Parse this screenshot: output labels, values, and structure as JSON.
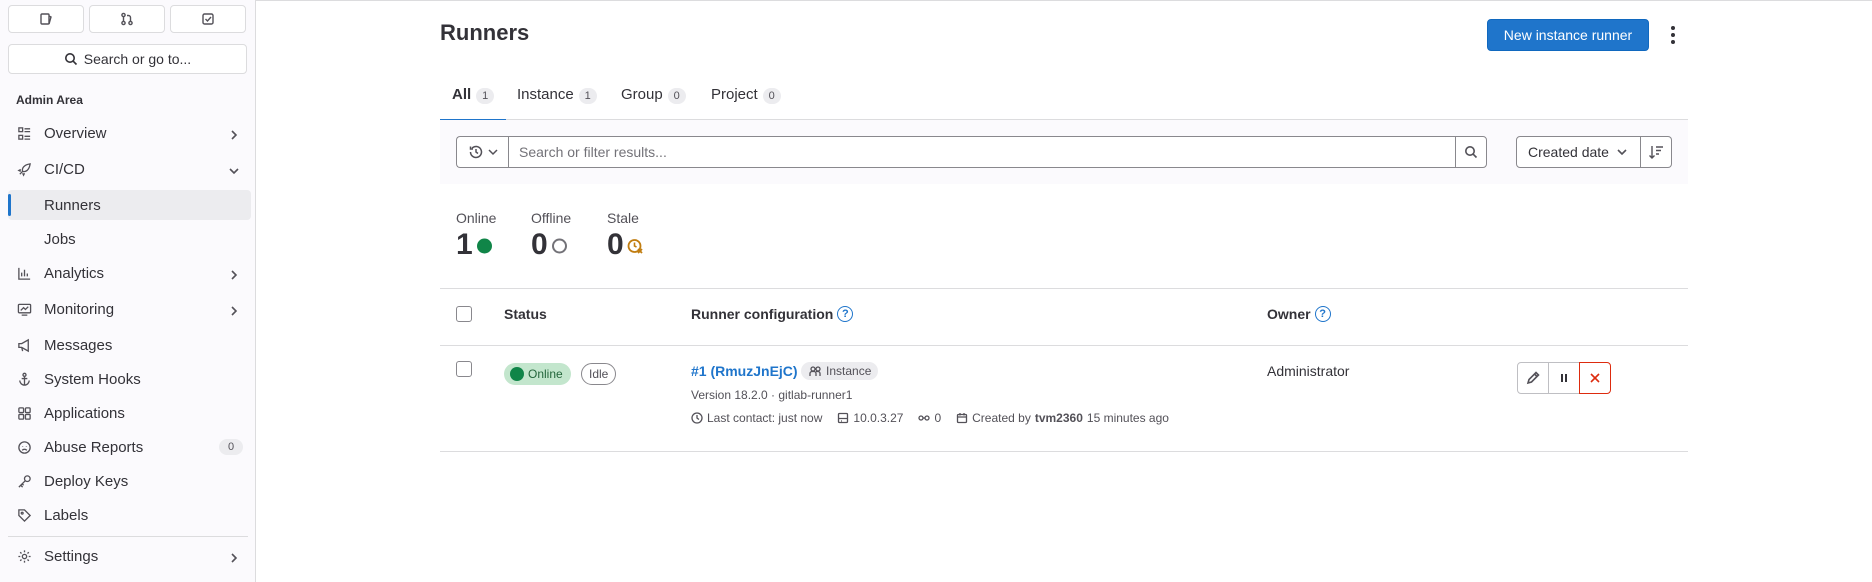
{
  "sidebar": {
    "top_icons": [
      "issues-icon",
      "merge-request-icon",
      "todo-icon"
    ],
    "search_label": "Search or go to...",
    "section_title": "Admin Area",
    "items": [
      {
        "label": "Overview",
        "icon": "overview-icon",
        "chevron": "right"
      },
      {
        "label": "CI/CD",
        "icon": "rocket-icon",
        "chevron": "down"
      },
      {
        "label": "Runners",
        "active": true
      },
      {
        "label": "Jobs"
      },
      {
        "label": "Analytics",
        "icon": "chart-icon",
        "chevron": "right"
      },
      {
        "label": "Monitoring",
        "icon": "monitor-icon",
        "chevron": "right"
      },
      {
        "label": "Messages",
        "icon": "bullhorn-icon"
      },
      {
        "label": "System Hooks",
        "icon": "anchor-icon"
      },
      {
        "label": "Applications",
        "icon": "applications-icon"
      },
      {
        "label": "Abuse Reports",
        "icon": "abuse-icon",
        "badge": "0"
      },
      {
        "label": "Deploy Keys",
        "icon": "key-icon"
      },
      {
        "label": "Labels",
        "icon": "label-icon"
      },
      {
        "label": "Settings",
        "icon": "gear-icon",
        "chevron": "right"
      }
    ]
  },
  "header": {
    "title": "Runners",
    "new_runner_label": "New instance runner"
  },
  "tabs": [
    {
      "label": "All",
      "count": "1",
      "active": true
    },
    {
      "label": "Instance",
      "count": "1"
    },
    {
      "label": "Group",
      "count": "0"
    },
    {
      "label": "Project",
      "count": "0"
    }
  ],
  "filter": {
    "placeholder": "Search or filter results...",
    "sort_label": "Created date"
  },
  "stats": [
    {
      "label": "Online",
      "value": "1",
      "indicator": "online-dot-icon"
    },
    {
      "label": "Offline",
      "value": "0",
      "indicator": "offline-circle-icon"
    },
    {
      "label": "Stale",
      "value": "0",
      "indicator": "stale-clock-icon"
    }
  ],
  "table": {
    "headers": {
      "status": "Status",
      "config": "Runner configuration",
      "owner": "Owner"
    },
    "rows": [
      {
        "status": "Online",
        "state": "Idle",
        "runner_name": "#1 (RmuzJnEjC)",
        "type": "Instance",
        "version": "Version 18.2.0 · gitlab-runner1",
        "last_contact": "Last contact: just now",
        "ip": "10.0.3.27",
        "jobs": "0",
        "created_prefix": "Created by",
        "created_by": "tvm2360",
        "created_ago": "15 minutes ago",
        "owner": "Administrator"
      }
    ]
  },
  "colors": {
    "accent": "#1f75cb",
    "online": "#108548",
    "stale": "#c17d10",
    "danger": "#dd2b0e"
  }
}
